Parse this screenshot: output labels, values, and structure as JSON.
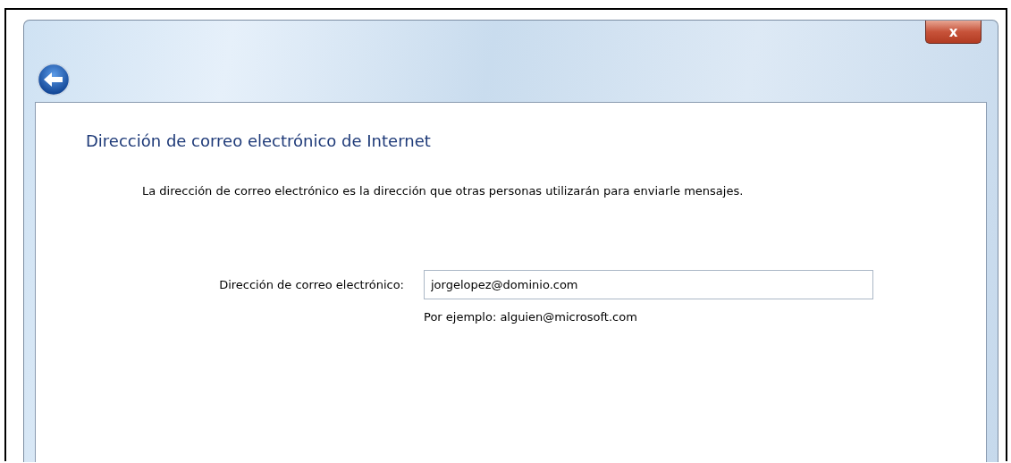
{
  "window": {
    "close_label": "x"
  },
  "page": {
    "title": "Dirección de correo electrónico de Internet",
    "description": "La dirección de correo electrónico es la dirección que otras personas utilizarán para enviarle mensajes.",
    "field": {
      "label": "Dirección de correo electrónico:",
      "value": "jorgelopez@dominio.com",
      "hint": "Por ejemplo: alguien@microsoft.com"
    }
  }
}
